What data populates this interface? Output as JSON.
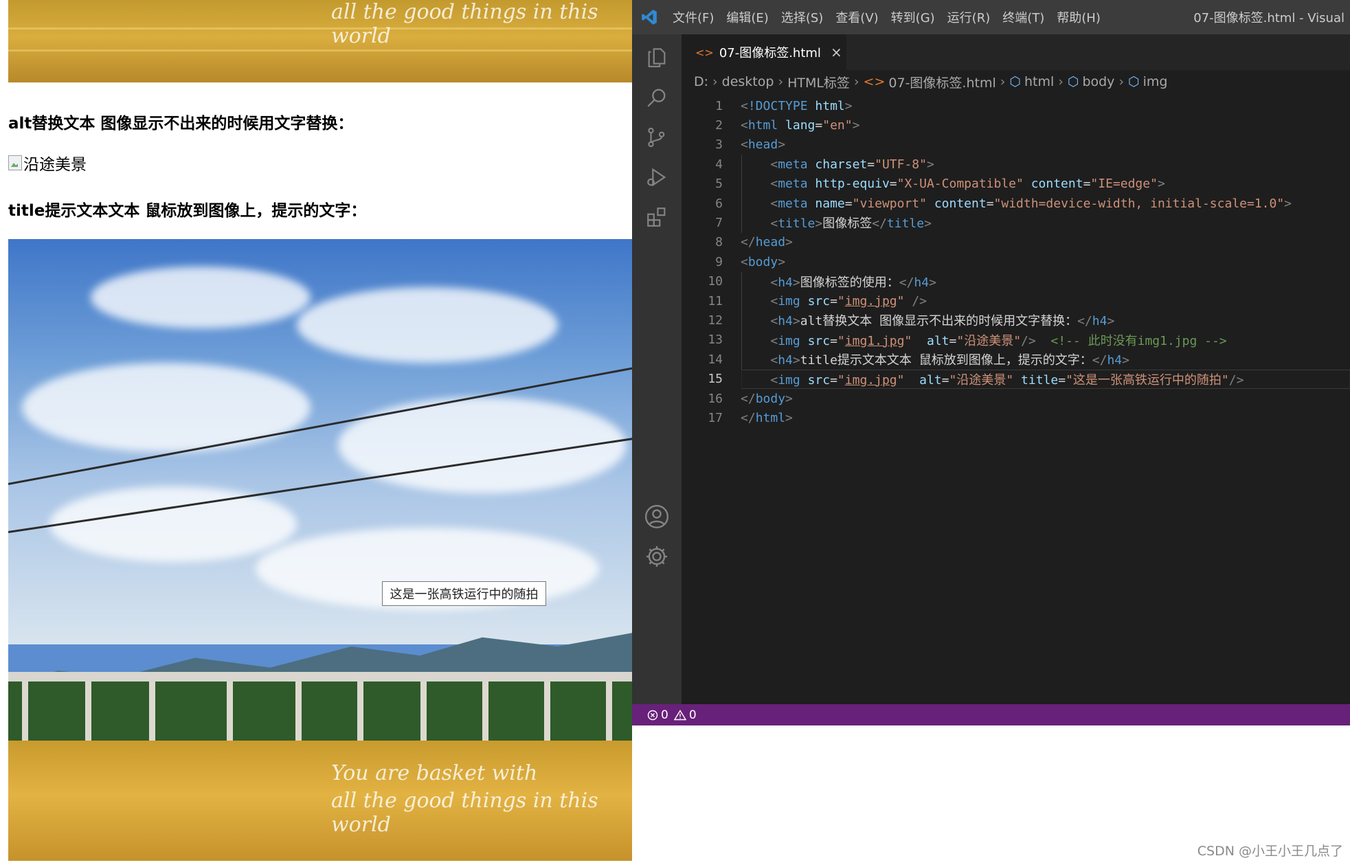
{
  "browser": {
    "h4_alt": "alt替换文本 图像显示不出来的时候用文字替换：",
    "broken_alt": "沿途美景",
    "h4_title": "title提示文本文本 鼠标放到图像上，提示的文字：",
    "tooltip": "这是一张高铁运行中的随拍"
  },
  "vscode": {
    "menu": [
      "文件(F)",
      "编辑(E)",
      "选择(S)",
      "查看(V)",
      "转到(G)",
      "运行(R)",
      "终端(T)",
      "帮助(H)"
    ],
    "window_title": "07-图像标签.html - Visual",
    "tab": {
      "label": "07-图像标签.html",
      "close": "×"
    },
    "breadcrumb": [
      "D:",
      "desktop",
      "HTML标签",
      "07-图像标签.html",
      "html",
      "body",
      "img"
    ],
    "current_line": 15,
    "lines": [
      {
        "n": "1",
        "t": [
          [
            "punct",
            "<"
          ],
          [
            "doc",
            "!DOCTYPE"
          ],
          [
            "txt",
            " "
          ],
          [
            "attr",
            "html"
          ],
          [
            "punct",
            ">"
          ]
        ]
      },
      {
        "n": "2",
        "t": [
          [
            "punct",
            "<"
          ],
          [
            "tag",
            "html"
          ],
          [
            "txt",
            " "
          ],
          [
            "attr",
            "lang"
          ],
          [
            "txt",
            "="
          ],
          [
            "str",
            "\"en\""
          ],
          [
            "punct",
            ">"
          ]
        ]
      },
      {
        "n": "3",
        "t": [
          [
            "punct",
            "<"
          ],
          [
            "tag",
            "head"
          ],
          [
            "punct",
            ">"
          ]
        ]
      },
      {
        "n": "4",
        "t": [
          [
            "txt",
            "    "
          ],
          [
            "punct",
            "<"
          ],
          [
            "tag",
            "meta"
          ],
          [
            "txt",
            " "
          ],
          [
            "attr",
            "charset"
          ],
          [
            "txt",
            "="
          ],
          [
            "str",
            "\"UTF-8\""
          ],
          [
            "punct",
            ">"
          ]
        ]
      },
      {
        "n": "5",
        "t": [
          [
            "txt",
            "    "
          ],
          [
            "punct",
            "<"
          ],
          [
            "tag",
            "meta"
          ],
          [
            "txt",
            " "
          ],
          [
            "attr",
            "http-equiv"
          ],
          [
            "txt",
            "="
          ],
          [
            "str",
            "\"X-UA-Compatible\""
          ],
          [
            "txt",
            " "
          ],
          [
            "attr",
            "content"
          ],
          [
            "txt",
            "="
          ],
          [
            "str",
            "\"IE=edge\""
          ],
          [
            "punct",
            ">"
          ]
        ]
      },
      {
        "n": "6",
        "t": [
          [
            "txt",
            "    "
          ],
          [
            "punct",
            "<"
          ],
          [
            "tag",
            "meta"
          ],
          [
            "txt",
            " "
          ],
          [
            "attr",
            "name"
          ],
          [
            "txt",
            "="
          ],
          [
            "str",
            "\"viewport\""
          ],
          [
            "txt",
            " "
          ],
          [
            "attr",
            "content"
          ],
          [
            "txt",
            "="
          ],
          [
            "str",
            "\"width=device-width, initial-scale=1.0\""
          ],
          [
            "punct",
            ">"
          ]
        ]
      },
      {
        "n": "7",
        "t": [
          [
            "txt",
            "    "
          ],
          [
            "punct",
            "<"
          ],
          [
            "tag",
            "title"
          ],
          [
            "punct",
            ">"
          ],
          [
            "txt",
            "图像标签"
          ],
          [
            "punct",
            "</"
          ],
          [
            "tag",
            "title"
          ],
          [
            "punct",
            ">"
          ]
        ]
      },
      {
        "n": "8",
        "t": [
          [
            "punct",
            "</"
          ],
          [
            "tag",
            "head"
          ],
          [
            "punct",
            ">"
          ]
        ]
      },
      {
        "n": "9",
        "t": [
          [
            "punct",
            "<"
          ],
          [
            "tag",
            "body"
          ],
          [
            "punct",
            ">"
          ]
        ]
      },
      {
        "n": "10",
        "t": [
          [
            "txt",
            "    "
          ],
          [
            "punct",
            "<"
          ],
          [
            "tag",
            "h4"
          ],
          [
            "punct",
            ">"
          ],
          [
            "txt",
            "图像标签的使用："
          ],
          [
            "punct",
            "</"
          ],
          [
            "tag",
            "h4"
          ],
          [
            "punct",
            ">"
          ]
        ]
      },
      {
        "n": "11",
        "t": [
          [
            "txt",
            "    "
          ],
          [
            "punct",
            "<"
          ],
          [
            "tag",
            "img"
          ],
          [
            "txt",
            " "
          ],
          [
            "attr",
            "src"
          ],
          [
            "txt",
            "="
          ],
          [
            "str",
            "\""
          ],
          [
            "strlink",
            "img.jpg"
          ],
          [
            "str",
            "\""
          ],
          [
            "txt",
            " "
          ],
          [
            "punct",
            "/>"
          ]
        ]
      },
      {
        "n": "12",
        "t": [
          [
            "txt",
            "    "
          ],
          [
            "punct",
            "<"
          ],
          [
            "tag",
            "h4"
          ],
          [
            "punct",
            ">"
          ],
          [
            "txt",
            "alt替换文本 图像显示不出来的时候用文字替换："
          ],
          [
            "punct",
            "</"
          ],
          [
            "tag",
            "h4"
          ],
          [
            "punct",
            ">"
          ]
        ]
      },
      {
        "n": "13",
        "t": [
          [
            "txt",
            "    "
          ],
          [
            "punct",
            "<"
          ],
          [
            "tag",
            "img"
          ],
          [
            "txt",
            " "
          ],
          [
            "attr",
            "src"
          ],
          [
            "txt",
            "="
          ],
          [
            "str",
            "\""
          ],
          [
            "strlink",
            "img1.jpg"
          ],
          [
            "str",
            "\""
          ],
          [
            "txt",
            "  "
          ],
          [
            "attr",
            "alt"
          ],
          [
            "txt",
            "="
          ],
          [
            "str",
            "\"沿途美景\""
          ],
          [
            "punct",
            "/>"
          ],
          [
            "txt",
            "  "
          ],
          [
            "com",
            "<!-- 此时没有img1.jpg -->"
          ]
        ]
      },
      {
        "n": "14",
        "t": [
          [
            "txt",
            "    "
          ],
          [
            "punct",
            "<"
          ],
          [
            "tag",
            "h4"
          ],
          [
            "punct",
            ">"
          ],
          [
            "txt",
            "title提示文本文本 鼠标放到图像上，提示的文字："
          ],
          [
            "punct",
            "</"
          ],
          [
            "tag",
            "h4"
          ],
          [
            "punct",
            ">"
          ]
        ]
      },
      {
        "n": "15",
        "t": [
          [
            "txt",
            "    "
          ],
          [
            "punct",
            "<"
          ],
          [
            "tag",
            "img"
          ],
          [
            "txt",
            " "
          ],
          [
            "attr",
            "src"
          ],
          [
            "txt",
            "="
          ],
          [
            "str",
            "\""
          ],
          [
            "strlink",
            "img.jpg"
          ],
          [
            "str",
            "\""
          ],
          [
            "txt",
            "  "
          ],
          [
            "attr",
            "alt"
          ],
          [
            "txt",
            "="
          ],
          [
            "str",
            "\"沿途美景\""
          ],
          [
            "txt",
            " "
          ],
          [
            "attr",
            "title"
          ],
          [
            "txt",
            "="
          ],
          [
            "str",
            "\"这是一张高铁运行中的随拍\""
          ],
          [
            "punct",
            "/>"
          ]
        ]
      },
      {
        "n": "16",
        "t": [
          [
            "punct",
            "</"
          ],
          [
            "tag",
            "body"
          ],
          [
            "punct",
            ">"
          ]
        ]
      },
      {
        "n": "17",
        "t": [
          [
            "punct",
            "</"
          ],
          [
            "tag",
            "html"
          ],
          [
            "punct",
            ">"
          ]
        ]
      }
    ],
    "status": {
      "errors": "0",
      "warnings": "0"
    },
    "colors": {
      "statusbar": "#68217a",
      "editor_bg": "#1e1e1e",
      "activity_bg": "#333333",
      "titlebar": "#3c3c3c"
    }
  },
  "watermark": "CSDN @小王小王几点了",
  "icons": [
    "vscode-logo-icon",
    "explorer-icon",
    "search-icon",
    "source-control-icon",
    "run-debug-icon",
    "extensions-icon",
    "account-icon",
    "settings-gear-icon",
    "html-file-icon",
    "close-icon",
    "cube-icon",
    "error-icon",
    "warning-icon"
  ]
}
